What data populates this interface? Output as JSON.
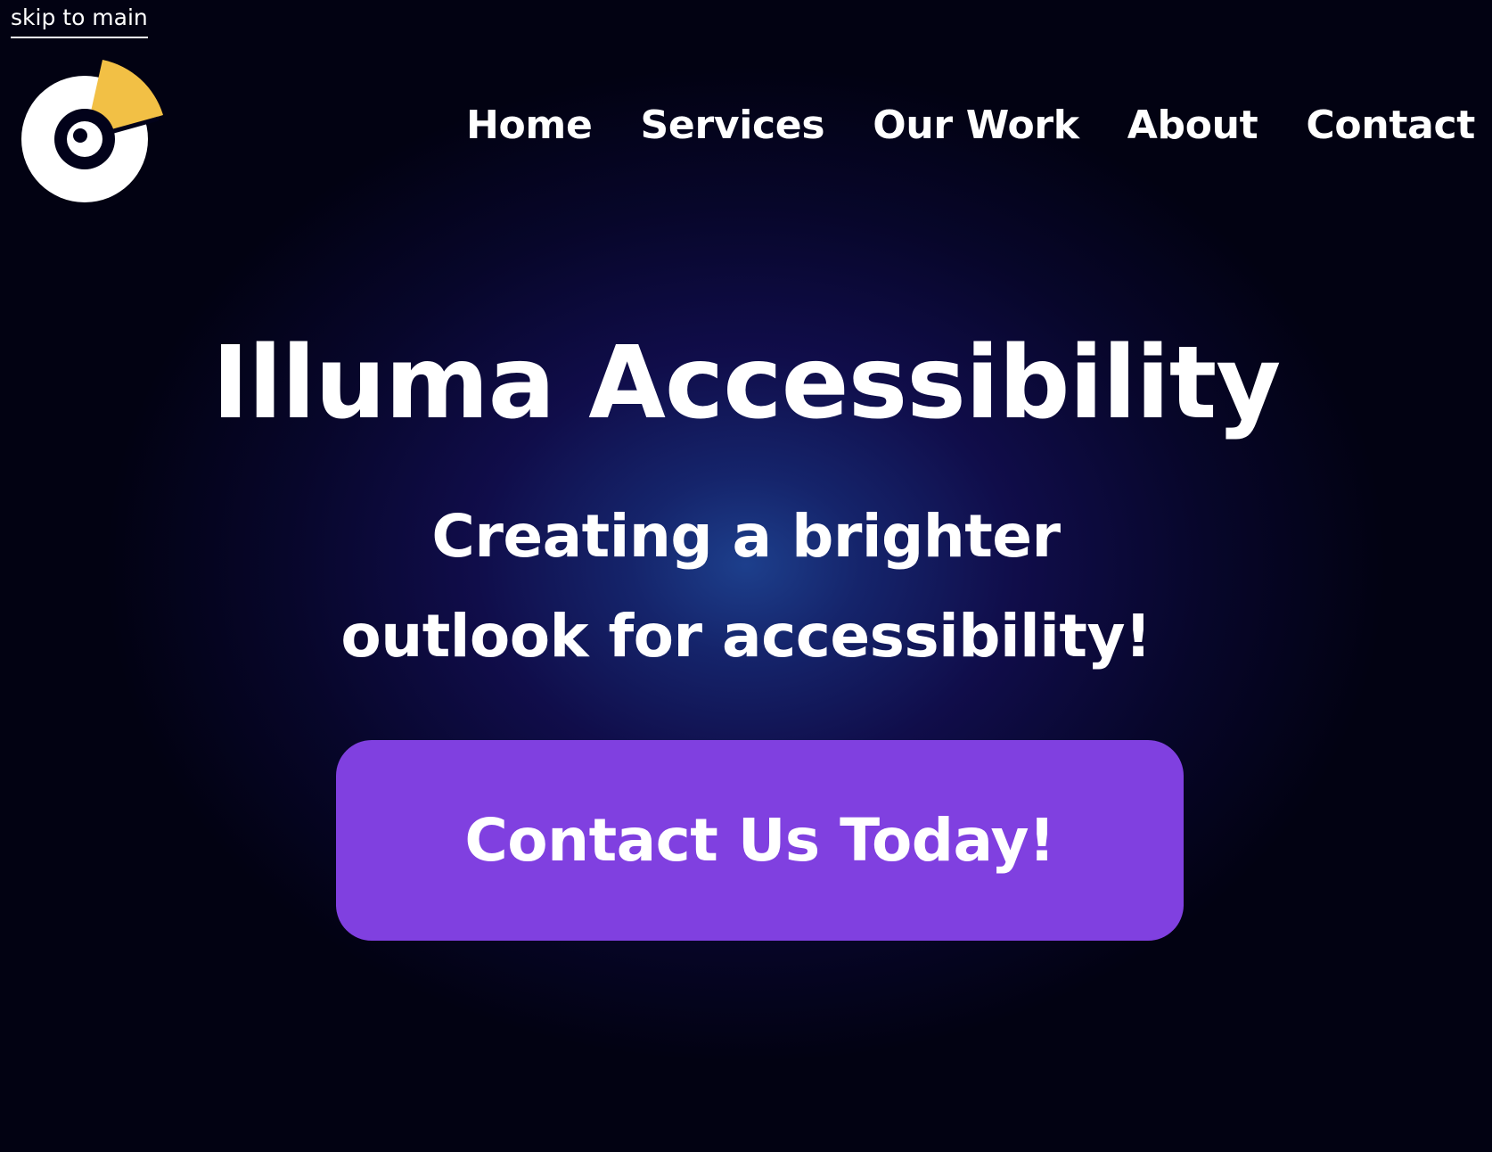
{
  "skip_link": {
    "label": "skip to main"
  },
  "header": {
    "logo_icon": "illuma-logo-icon",
    "nav": [
      {
        "label": "Home"
      },
      {
        "label": "Services"
      },
      {
        "label": "Our Work"
      },
      {
        "label": "About"
      },
      {
        "label": "Contact"
      }
    ]
  },
  "hero": {
    "title": "Illuma Accessibility",
    "tagline": "Creating a brighter outlook for accessibility!",
    "cta_label": "Contact Us Today!"
  },
  "colors": {
    "background_center": "#1d3f8c",
    "background_edge": "#020212",
    "cta_background": "#8040e0",
    "logo_accent": "#f2c045",
    "text": "#ffffff"
  }
}
